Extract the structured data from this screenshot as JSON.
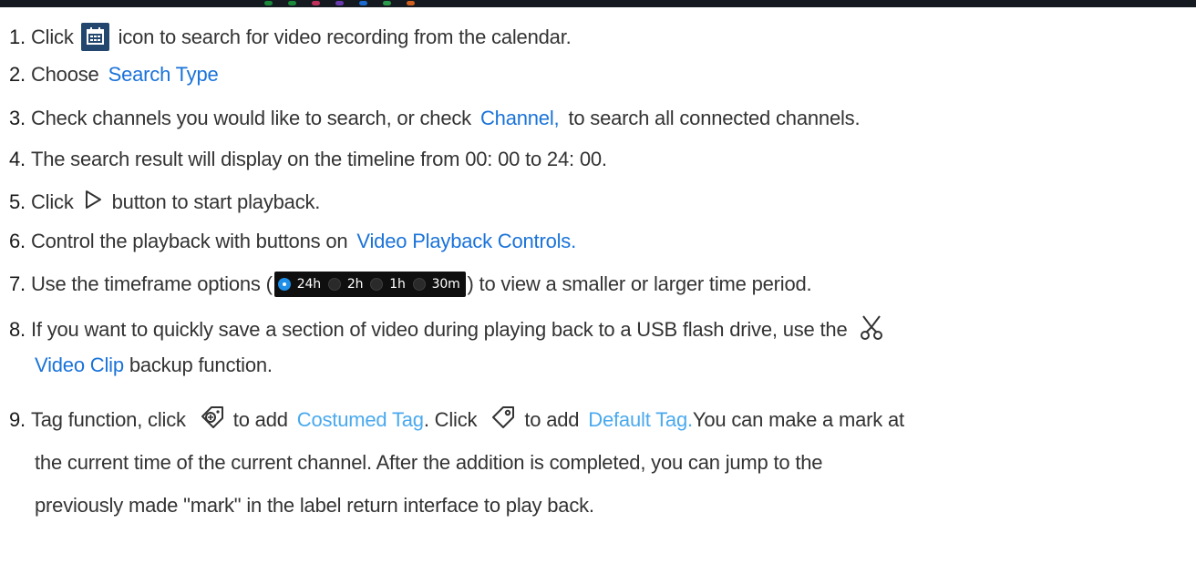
{
  "topbar": {
    "dot_colors": [
      "#1a8a3a",
      "#1a8a3a",
      "#c0305a",
      "#6a3ab0",
      "#1a6ad0",
      "#2a9a4a",
      "#d06020"
    ]
  },
  "items": {
    "1": {
      "num": "1.",
      "a": "Click",
      "b": "icon to search for video recording from the calendar."
    },
    "2": {
      "num": "2.",
      "a": "Choose",
      "link": "Search Type"
    },
    "3": {
      "num": "3.",
      "a": "Check channels you would like to search, or check",
      "link": "Channel,",
      "b": "to search all connected channels."
    },
    "4": {
      "num": "4.",
      "a": "The search result will display on the timeline from 00: 00 to 24: 00."
    },
    "5": {
      "num": "5.",
      "a": "Click",
      "b": "button to start playback."
    },
    "6": {
      "num": "6.",
      "a": "Control the playback with buttons on",
      "link": "Video Playback Controls."
    },
    "7": {
      "num": "7.",
      "a": "Use the timeframe options (",
      "b": ") to view a smaller or larger time period.",
      "options": [
        "24h",
        "2h",
        "1h",
        "30m"
      ],
      "selected": "24h"
    },
    "8": {
      "num": "8.",
      "a": "If you want to quickly save a section of video during playing back to a USB flash drive, use the",
      "link": "Video Clip",
      "b": "backup function."
    },
    "9": {
      "num": "9.",
      "a": "Tag function, click",
      "link1": "Costumed Tag",
      "b": "to add",
      "c": ". Click",
      "d": "to add",
      "link2": "Default Tag.",
      "e": "You can make a mark at",
      "line2": "the current time of the current channel. After the addition is completed, you can jump to the",
      "line3": "previously made \"mark\" in the label return interface to play back."
    }
  },
  "icons": {
    "calendar": "calendar-icon",
    "play": "play-triangle-icon",
    "scissors": "scissors-icon",
    "tag_add": "tag-add-icon",
    "tag_default": "tag-icon"
  },
  "colors": {
    "link": "#1a73d9",
    "link_light": "#4aa9ee",
    "calendar_bg": "#23466e",
    "timeframe_bg": "#0f0f0f",
    "radio_selected": "#1f8fe8"
  }
}
